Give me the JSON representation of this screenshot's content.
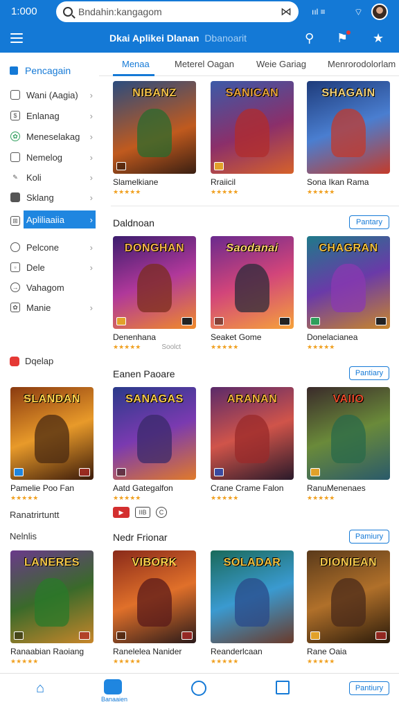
{
  "status": {
    "time": "1:000",
    "signal": "ııl ≡"
  },
  "search": {
    "value": "Bndahin:kangagom"
  },
  "header": {
    "title": "Dkai Aplikei Dlanan",
    "subtitle": "Dbanoarit"
  },
  "tabs": [
    {
      "label": "Menaa"
    },
    {
      "label": "Meterel Oagan"
    },
    {
      "label": "Weie Gariag"
    },
    {
      "label": "Menrorodolorlam"
    }
  ],
  "sidebar": {
    "heading": "Pencagain",
    "items": [
      {
        "label": "Wani (Aagia)",
        "icon": "square-icon"
      },
      {
        "label": "Enlanag",
        "icon": "dollar-icon"
      },
      {
        "label": "Meneselakag",
        "icon": "leaf-icon"
      },
      {
        "label": "Nemelog",
        "icon": "file-icon"
      },
      {
        "label": "Koli",
        "icon": "pen-icon"
      },
      {
        "label": "Sklang",
        "icon": "chart-icon"
      },
      {
        "label": "Apliliaaiia",
        "icon": "grid-icon"
      },
      {
        "label": "Pelcone",
        "icon": "circle-icon"
      },
      {
        "label": "Dele",
        "icon": "box-icon"
      },
      {
        "label": "Vahagom",
        "icon": "compass-icon"
      },
      {
        "label": "Manie",
        "icon": "leaf-icon"
      }
    ],
    "extra_1": "Dqelap",
    "extra_2": "Ranatrirtuntt",
    "extra_3": "Nelnlis"
  },
  "sections": [
    {
      "title": "",
      "cards": [
        {
          "title_art": "NIBANZ",
          "name": "Slamelkiane",
          "stars": "★★★★★"
        },
        {
          "title_art": "SANICAN",
          "name": "Rraiicil",
          "stars": "★★★★★"
        },
        {
          "title_art": "SHAGAIN",
          "name": "Sona Ikan Rama",
          "stars": "★★★★★"
        }
      ]
    },
    {
      "title": "Daldnoan",
      "button": "Pantary",
      "cards": [
        {
          "title_art": "DONGHAN",
          "name": "Denenhana",
          "stars": "★★★★★",
          "extra": "Soolct"
        },
        {
          "title_art": "Saodanai",
          "name": "Seaket Gome",
          "stars": "★★★★★"
        },
        {
          "title_art": "CHAGRAN",
          "name": "Donelacianea",
          "stars": "★★★★★"
        }
      ]
    },
    {
      "title": "Eanen Paoare",
      "button": "Pantiary",
      "cards": [
        {
          "title_art": "SLANDAN",
          "name": "Pamelie Poo Fan",
          "stars": "★★★★★"
        },
        {
          "title_art": "SANAGAS",
          "name": "Aatd Gategalfon",
          "stars": "★★★★★"
        },
        {
          "title_art": "ARANAN",
          "name": "Crane Crame Falon",
          "stars": "★★★★★"
        },
        {
          "title_art": "VAIIO",
          "name": "RanuMenenaes",
          "stars": "★★★★★"
        }
      ]
    },
    {
      "title": "Nedr Frionar",
      "button": "Pamiury",
      "cards": [
        {
          "title_art": "LANERES",
          "name": "Ranaabian Raoiang",
          "stars": "★★★★★"
        },
        {
          "title_art": "VIBORK",
          "name": "Ranelelea Nanider",
          "stars": "★★★★★"
        },
        {
          "title_art": "SOLADAR",
          "name": "Reanderlcaan",
          "stars": "★★★★★"
        },
        {
          "title_art": "DIONIEAN",
          "name": "Rane Oaia",
          "stars": "★★★★★"
        }
      ]
    }
  ],
  "mini_badges": [
    "▶",
    "IIB",
    "C"
  ],
  "bottom_nav": {
    "active_label": "Banaaien",
    "more_button": "Pantiury"
  },
  "colors": {
    "brand": "#1479d6",
    "star": "#f0a020",
    "active": "#1f86e0"
  }
}
